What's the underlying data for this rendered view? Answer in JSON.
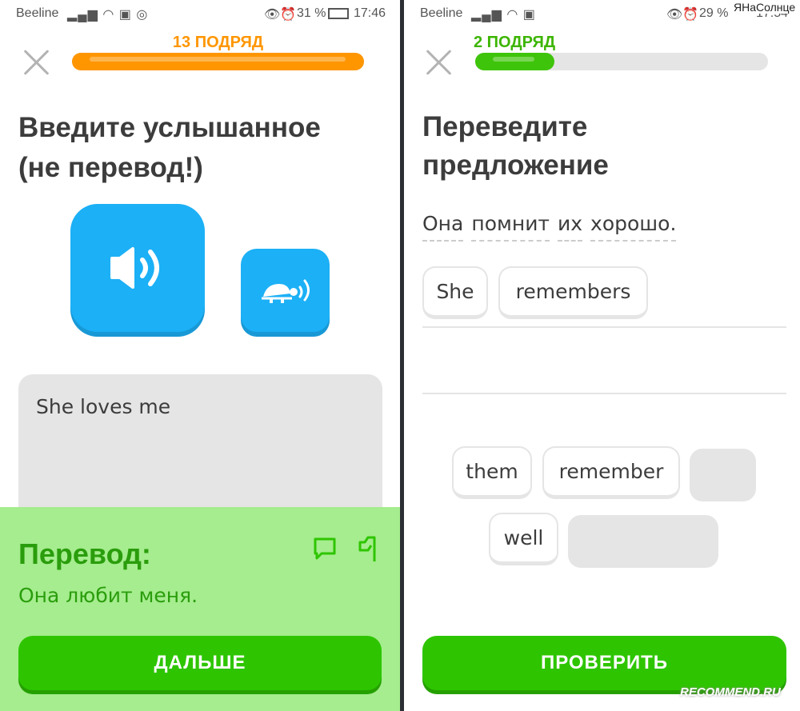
{
  "left": {
    "status": {
      "carrier": "Beeline",
      "battery": "31 %",
      "time": "17:46"
    },
    "streak": "13 ПОДРЯД",
    "progress": 1.0,
    "accent": "#ff9600",
    "title_line1": "Введите услышанное",
    "title_line2": "(не перевод!)",
    "speaker_icon": "speaker-icon",
    "slow_icon": "turtle-icon",
    "answer": "She loves me",
    "feedback": {
      "title": "Перевод:",
      "text": "Она любит меня.",
      "bg": "#a5ed8e"
    },
    "button": "ДАЛЬШЕ"
  },
  "right": {
    "status": {
      "carrier": "Beeline",
      "battery": "29 %",
      "time": "17:54"
    },
    "streak": "2 ПОДРЯД",
    "progress": 0.27,
    "accent": "#58cc02",
    "title_line1": "Переведите",
    "title_line2": "предложение",
    "sentence_words": [
      "Она",
      "помнит",
      "их",
      "хорошо."
    ],
    "answer_chips": [
      "She",
      "remembers"
    ],
    "bank": [
      "them",
      "remember",
      "well"
    ],
    "button": "ПРОВЕРИТЬ"
  },
  "watermark": "RECOMMEND.RU",
  "watermark_user": "ЯНаСолнце"
}
